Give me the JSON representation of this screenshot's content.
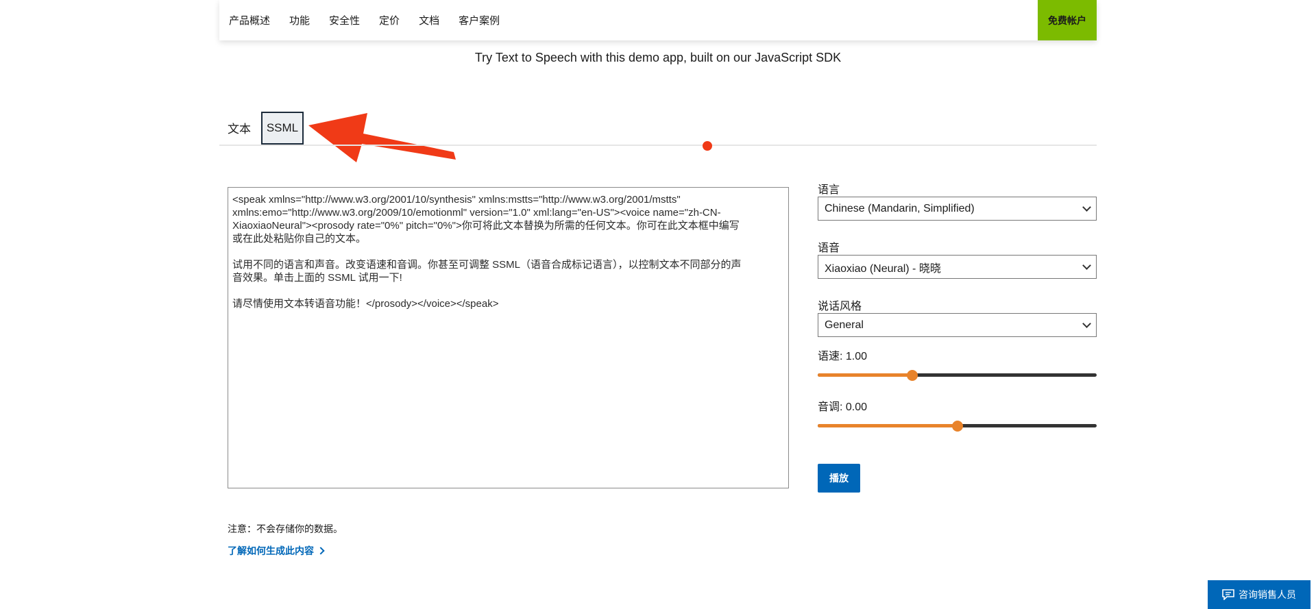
{
  "nav": {
    "items": [
      "产品概述",
      "功能",
      "安全性",
      "定价",
      "文档",
      "客户案例"
    ],
    "cta": "免费帐户"
  },
  "subtitle": "Try Text to Speech with this demo app, built on our JavaScript SDK",
  "tabs": {
    "text": "文本",
    "ssml": "SSML"
  },
  "ssml_text": "<speak xmlns=\"http://www.w3.org/2001/10/synthesis\" xmlns:mstts=\"http://www.w3.org/2001/mstts\"\nxmlns:emo=\"http://www.w3.org/2009/10/emotionml\" version=\"1.0\" xml:lang=\"en-US\"><voice name=\"zh-CN-\nXiaoxiaoNeural\"><prosody rate=\"0%\" pitch=\"0%\">你可将此文本替换为所需的任何文本。你可在此文本框中编写\n或在此处粘贴你自己的文本。\n\n试用不同的语言和声音。改变语速和音调。你甚至可调整 SSML（语音合成标记语言），以控制文本不同部分的声\n音效果。单击上面的 SSML 试用一下!\n\n请尽情使用文本转语音功能！</prosody></voice></speak>",
  "language": {
    "label": "语言",
    "value": "Chinese (Mandarin, Simplified)"
  },
  "voice": {
    "label": "语音",
    "value": "Xiaoxiao (Neural) - 晓晓"
  },
  "style": {
    "label": "说话风格",
    "value": "General"
  },
  "rate": {
    "label": "语速: 1.00",
    "fraction": 0.34
  },
  "pitch": {
    "label": "音调: 0.00",
    "fraction": 0.5
  },
  "play_label": "播放",
  "note": "注意：不会存储你的数据。",
  "learn_link": "了解如何生成此内容",
  "sales_label": "咨询销售人员",
  "colors": {
    "accent": "#0067b8",
    "cta": "#7cbb00",
    "slider": "#e8832b",
    "annotation": "#f03a17"
  }
}
